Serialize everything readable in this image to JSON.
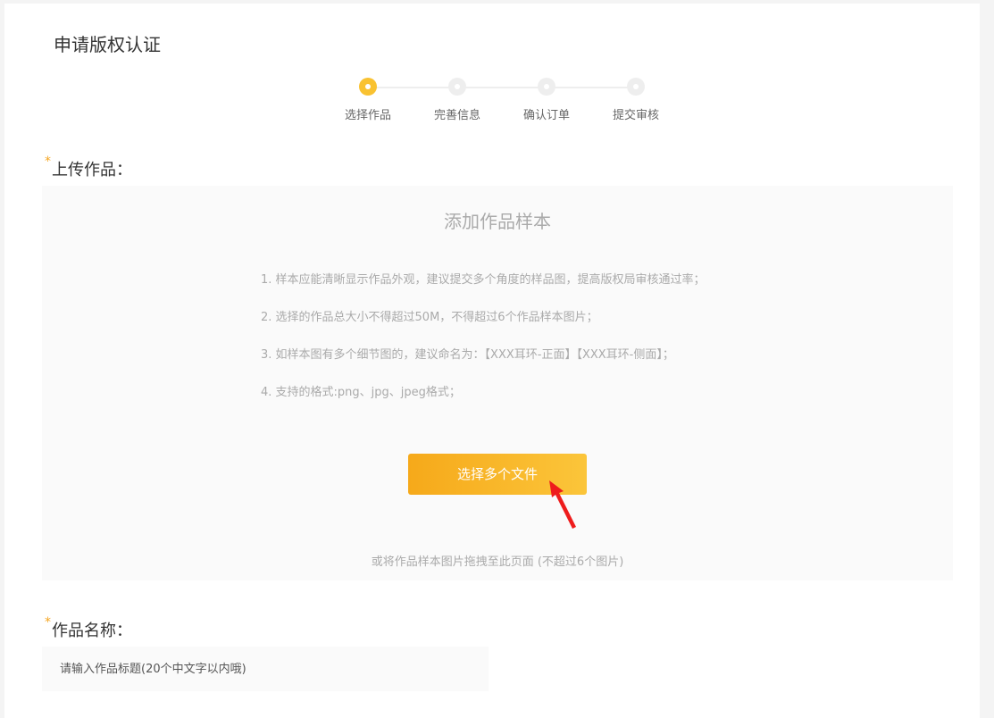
{
  "page": {
    "title": "申请版权认证"
  },
  "stepper": {
    "steps": [
      {
        "label": "选择作品",
        "active": true
      },
      {
        "label": "完善信息",
        "active": false
      },
      {
        "label": "确认订单",
        "active": false
      },
      {
        "label": "提交审核",
        "active": false
      }
    ]
  },
  "upload": {
    "required_mark": "*",
    "section_label": "上传作品：",
    "title": "添加作品样本",
    "rules": [
      "1. 样本应能清晰显示作品外观，建议提交多个角度的样品图，提高版权局审核通过率；",
      "2. 选择的作品总大小不得超过50M，不得超过6个作品样本图片；",
      "3. 如样本图有多个细节图的，建议命名为：【XXX耳环-正面】【XXX耳环-侧面】；",
      "4. 支持的格式:png、jpg、jpeg格式；"
    ],
    "button_label": "选择多个文件",
    "drop_hint": "或将作品样本图片拖拽至此页面 (不超过6个图片)"
  },
  "work_name": {
    "required_mark": "*",
    "section_label": "作品名称：",
    "placeholder": "请输入作品标题(20个中文字以内哦)",
    "value": ""
  },
  "colors": {
    "accent": "#f9c231",
    "button_start": "#f6a91a",
    "button_end": "#fbc53a",
    "required": "#f5a623",
    "arrow": "#ee1c1c"
  }
}
